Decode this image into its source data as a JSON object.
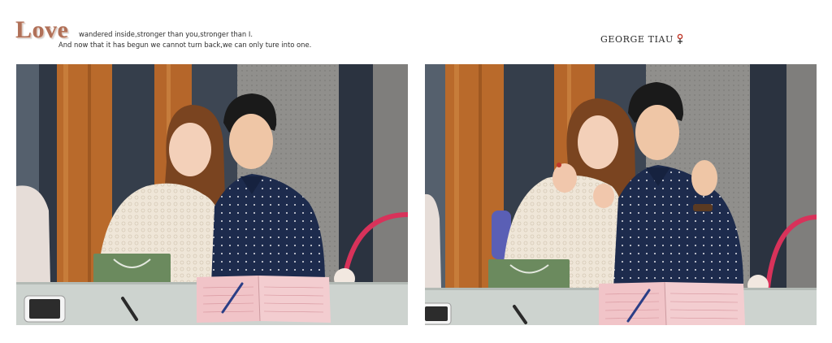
{
  "header": {
    "love_word": "Love",
    "line1": "wandered inside,stronger than you,stronger than I.",
    "line2": "And now that it has begun we cannot turn back,we can only ture into one."
  },
  "brand": {
    "logo_text": "GEORGE TIAU",
    "logo_icon": "georgetiau-logo-icon",
    "accent": "#c0392b"
  },
  "photos": [
    {
      "name": "couple-photo-smiling",
      "pose": "seated couple smiling at signing table"
    },
    {
      "name": "couple-photo-finger-hearts",
      "pose": "seated couple making finger-heart gestures"
    }
  ],
  "colors": {
    "wall_dark": "#3a4452",
    "wood": "#b86a2c",
    "shirt_navy": "#1d2b4d",
    "lace": "#efe6d8",
    "table": "#cfd5d1",
    "guestbook": "#f1c4c8",
    "basket": "#d8325a"
  }
}
